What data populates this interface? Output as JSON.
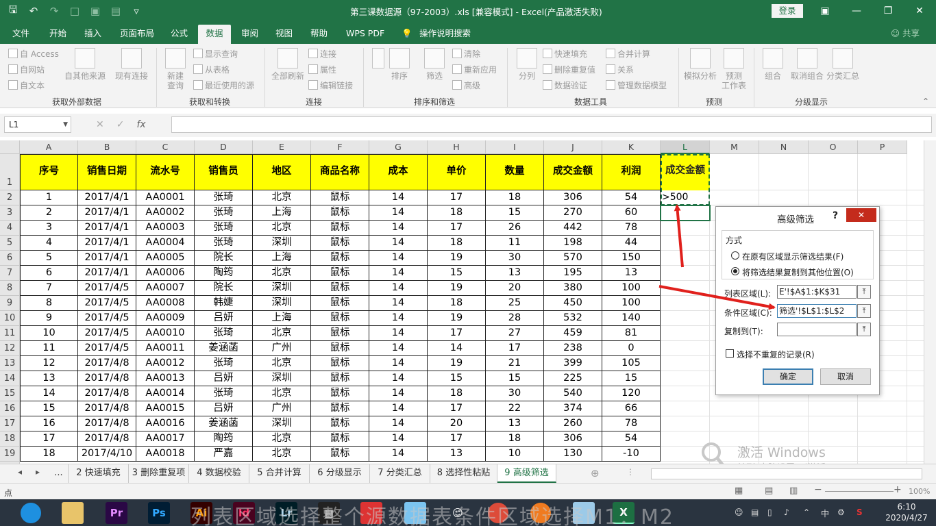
{
  "window": {
    "title": "第三课数据源（97-2003）.xls  [兼容模式]  -  Excel(产品激活失败)",
    "login": "登录"
  },
  "tabs": [
    "文件",
    "开始",
    "插入",
    "页面布局",
    "公式",
    "数据",
    "审阅",
    "视图",
    "帮助",
    "WPS PDF",
    "操作说明搜索"
  ],
  "share": "共享",
  "ribbon": {
    "groups": {
      "get_external": "获取外部数据",
      "get_transform": "获取和转换",
      "connections": "连接",
      "sort_filter": "排序和筛选",
      "data_tools": "数据工具",
      "forecast": "预测",
      "outline": "分级显示"
    },
    "ext": [
      "自 Access",
      "自网站",
      "自文本"
    ],
    "from_other": "自其他来源",
    "existing": "现有连接",
    "new_query": "新建\n查询",
    "transform": [
      "显示查询",
      "从表格",
      "最近使用的源"
    ],
    "refresh_all": "全部刷新",
    "conn": [
      "连接",
      "属性",
      "编辑链接"
    ],
    "sort": "排序",
    "filter": "筛选",
    "filter_opts": [
      "清除",
      "重新应用",
      "高级"
    ],
    "split": "分列",
    "tools": [
      "快速填充",
      "删除重复值",
      "数据验证"
    ],
    "tools2": [
      "合并计算",
      "关系",
      "管理数据模型"
    ],
    "whatif": "模拟分析",
    "forecast_sheet": "预测\n工作表",
    "outline_btns": [
      "组合",
      "取消组合",
      "分类汇总"
    ]
  },
  "formula_bar": {
    "name_box": "L1",
    "fx": "fx",
    "value": ""
  },
  "columns": [
    "A",
    "B",
    "C",
    "D",
    "E",
    "F",
    "G",
    "H",
    "I",
    "J",
    "K",
    "L",
    "M",
    "N",
    "O",
    "P"
  ],
  "table_headers": [
    "序号",
    "销售日期",
    "流水号",
    "销售员",
    "地区",
    "商品名称",
    "成本",
    "单价",
    "数量",
    "成交金额",
    "利润"
  ],
  "rows": [
    [
      "1",
      "2017/4/1",
      "AA0001",
      "张琦",
      "北京",
      "鼠标",
      "14",
      "17",
      "18",
      "306",
      "54"
    ],
    [
      "2",
      "2017/4/1",
      "AA0002",
      "张琦",
      "上海",
      "鼠标",
      "14",
      "18",
      "15",
      "270",
      "60"
    ],
    [
      "3",
      "2017/4/1",
      "AA0003",
      "张琦",
      "北京",
      "鼠标",
      "14",
      "17",
      "26",
      "442",
      "78"
    ],
    [
      "4",
      "2017/4/1",
      "AA0004",
      "张琦",
      "深圳",
      "鼠标",
      "14",
      "18",
      "11",
      "198",
      "44"
    ],
    [
      "5",
      "2017/4/1",
      "AA0005",
      "院长",
      "上海",
      "鼠标",
      "14",
      "19",
      "30",
      "570",
      "150"
    ],
    [
      "6",
      "2017/4/1",
      "AA0006",
      "陶筠",
      "北京",
      "鼠标",
      "14",
      "15",
      "13",
      "195",
      "13"
    ],
    [
      "7",
      "2017/4/5",
      "AA0007",
      "院长",
      "深圳",
      "鼠标",
      "14",
      "19",
      "20",
      "380",
      "100"
    ],
    [
      "8",
      "2017/4/5",
      "AA0008",
      "韩婕",
      "深圳",
      "鼠标",
      "14",
      "18",
      "25",
      "450",
      "100"
    ],
    [
      "9",
      "2017/4/5",
      "AA0009",
      "吕妍",
      "上海",
      "鼠标",
      "14",
      "19",
      "28",
      "532",
      "140"
    ],
    [
      "10",
      "2017/4/5",
      "AA0010",
      "张琦",
      "北京",
      "鼠标",
      "14",
      "17",
      "27",
      "459",
      "81"
    ],
    [
      "11",
      "2017/4/5",
      "AA0011",
      "姜涵菡",
      "广州",
      "鼠标",
      "14",
      "14",
      "17",
      "238",
      "0"
    ],
    [
      "12",
      "2017/4/8",
      "AA0012",
      "张琦",
      "北京",
      "鼠标",
      "14",
      "19",
      "21",
      "399",
      "105"
    ],
    [
      "13",
      "2017/4/8",
      "AA0013",
      "吕妍",
      "深圳",
      "鼠标",
      "14",
      "15",
      "15",
      "225",
      "15"
    ],
    [
      "14",
      "2017/4/8",
      "AA0014",
      "张琦",
      "北京",
      "鼠标",
      "14",
      "18",
      "30",
      "540",
      "120"
    ],
    [
      "15",
      "2017/4/8",
      "AA0015",
      "吕妍",
      "广州",
      "鼠标",
      "14",
      "17",
      "22",
      "374",
      "66"
    ],
    [
      "16",
      "2017/4/8",
      "AA0016",
      "姜涵菡",
      "深圳",
      "鼠标",
      "14",
      "20",
      "13",
      "260",
      "78"
    ],
    [
      "17",
      "2017/4/8",
      "AA0017",
      "陶筠",
      "北京",
      "鼠标",
      "14",
      "17",
      "18",
      "306",
      "54"
    ],
    [
      "18",
      "2017/4/10",
      "AA0018",
      "严嘉",
      "北京",
      "鼠标",
      "14",
      "13",
      "10",
      "130",
      "-10"
    ]
  ],
  "criteria": {
    "header": "成交金额",
    "value": ">500"
  },
  "dialog": {
    "title": "高级筛选",
    "help": "?",
    "close": "✕",
    "mode_label": "方式",
    "option1": "在原有区域显示筛选结果(F)",
    "option2": "将筛选结果复制到其他位置(O)",
    "list_range_label": "列表区域(L):",
    "list_range_value": "E'!$A$1:$K$31",
    "criteria_range_label": "条件区域(C):",
    "criteria_range_value": "筛选'!$L$1:$L$2",
    "copy_to_label": "复制到(T):",
    "copy_to_value": "",
    "unique_label": "选择不重复的记录(R)",
    "ok": "确定",
    "cancel": "取消"
  },
  "sheets": [
    "...",
    "2 快速填充",
    "3 删除重复项",
    "4 数据校验",
    "5 合并计算",
    "6 分级显示",
    "7 分类汇总",
    "8 选择性粘贴",
    "9 高级筛选"
  ],
  "status": {
    "mode": "点",
    "zoom": "100%"
  },
  "activation": {
    "line1": "激活 Windows",
    "line2": "转到\"电脑设置\"以激活 Windows。"
  },
  "taskbar": {
    "apps": [
      "Pr",
      "Ps",
      "Ai",
      "Id",
      "Lr"
    ],
    "caption": "列表区域选择整个源数据表条件区域选择M1：M2",
    "time": "6:10",
    "date": "2020/4/27",
    "ime": "中"
  },
  "colors": {
    "accent": "#217346",
    "header_fill": "#ffff00",
    "arrow": "#e0201c"
  }
}
